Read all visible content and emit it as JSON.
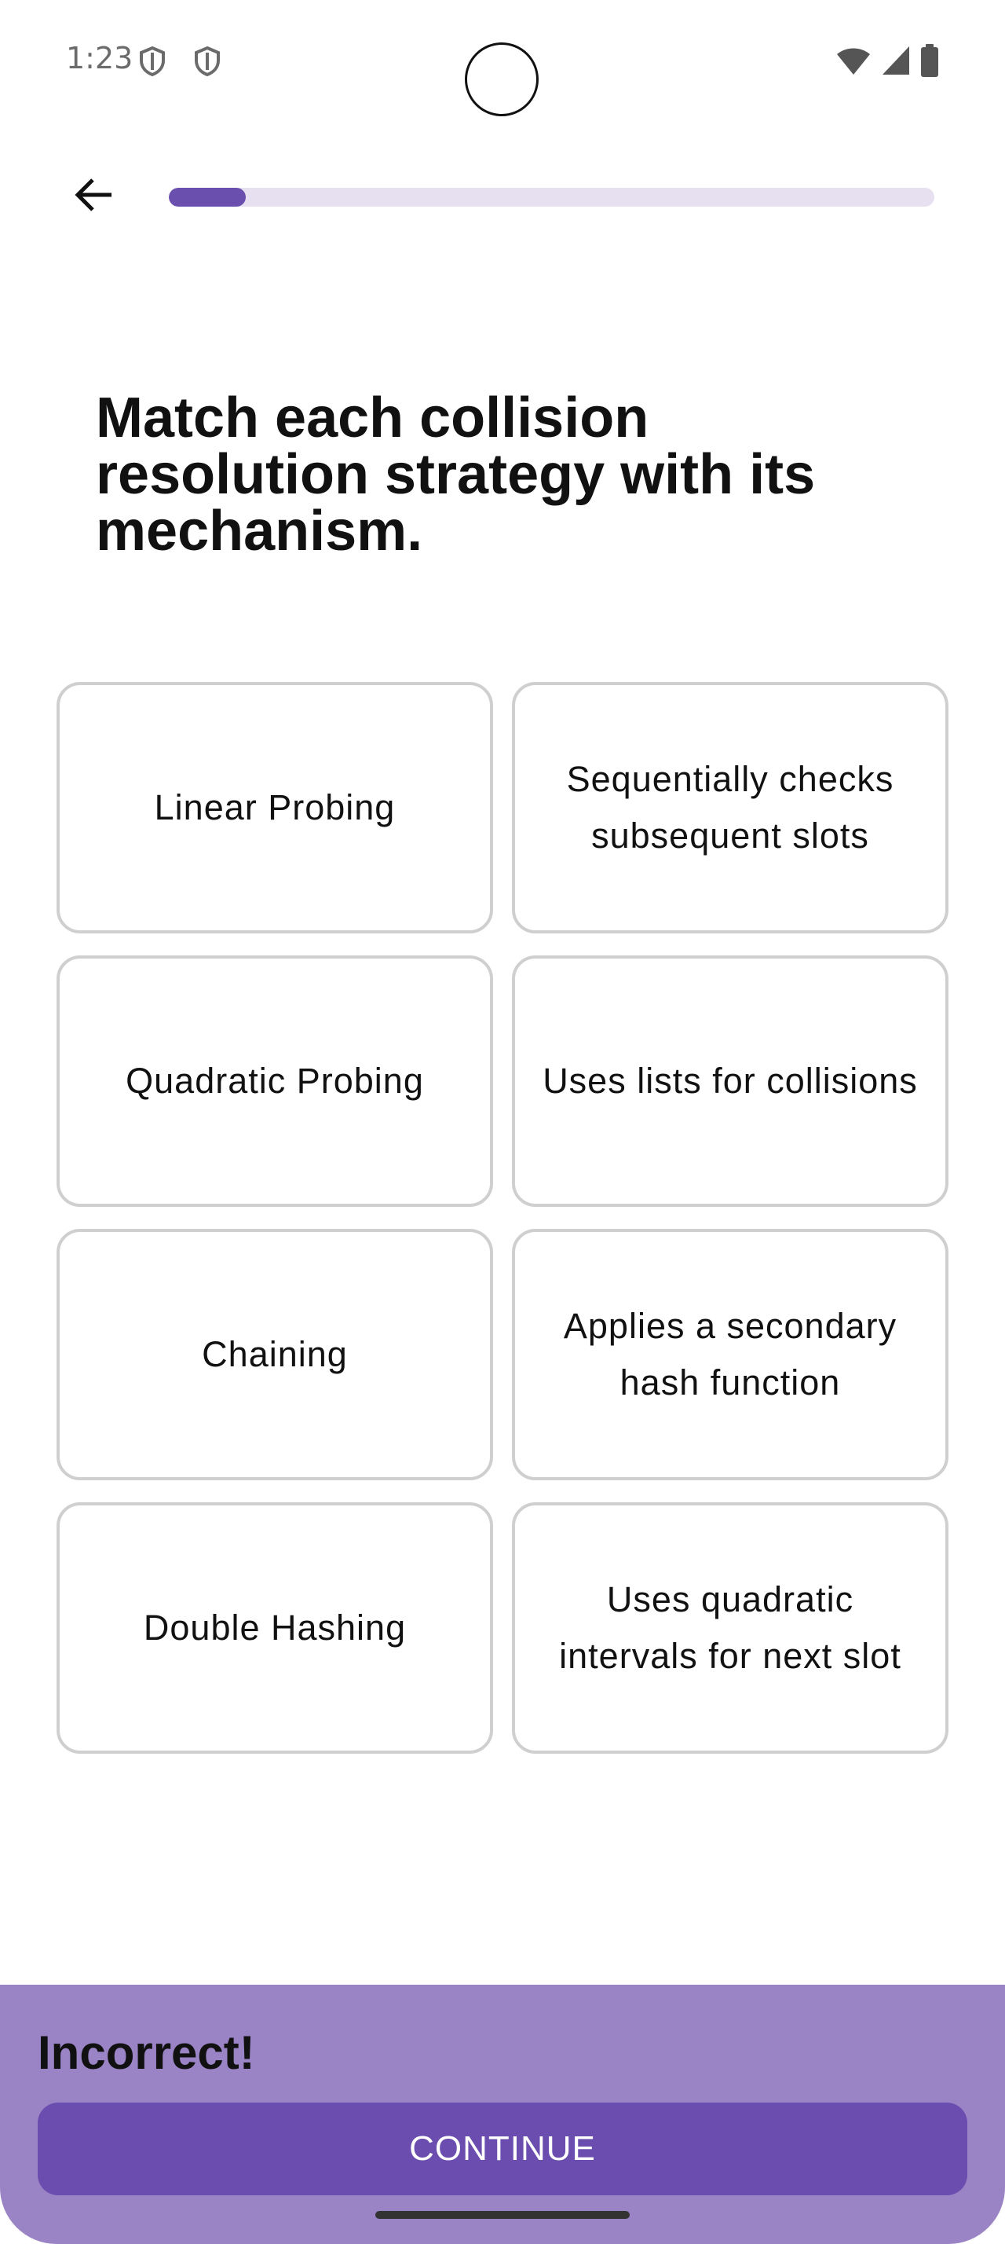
{
  "status_bar": {
    "time": "1:23",
    "icons": [
      "shield-icon",
      "shield-icon",
      "wifi-icon",
      "signal-icon",
      "battery-icon"
    ]
  },
  "nav": {
    "back_icon": "arrow-left-icon",
    "progress_fraction": 0.1
  },
  "question": {
    "title": "Match each collision resolution strategy with its mechanism."
  },
  "cards": {
    "left": [
      "Linear Probing",
      "Quadratic Probing",
      "Chaining",
      "Double Hashing"
    ],
    "right": [
      "Sequentially checks subsequent slots",
      "Uses lists for collisions",
      "Applies a secondary hash function",
      "Uses quadratic intervals for next slot"
    ]
  },
  "feedback": {
    "message": "Incorrect!",
    "continue_label": "CONTINUE"
  },
  "colors": {
    "accent": "#6b4fae",
    "progress_track": "#e7e0f1",
    "feedback_bg": "#9a84c6",
    "button_bg": "#6a4dae",
    "card_border": "#cfcfcf"
  }
}
